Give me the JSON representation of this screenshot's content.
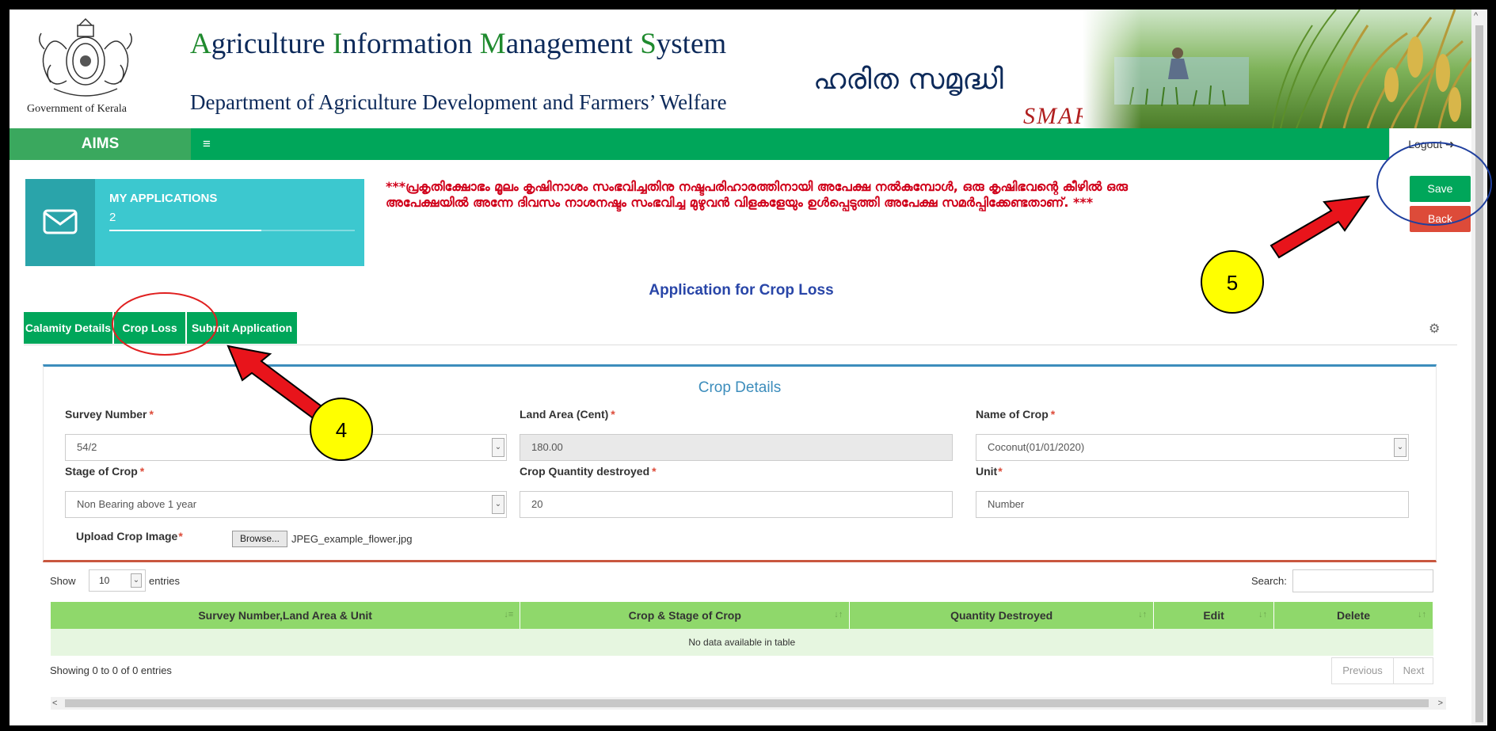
{
  "header": {
    "gov_label": "Government of Kerala",
    "title_parts": [
      {
        "cap": "A",
        "rest": "griculture "
      },
      {
        "cap": "I",
        "rest": "nformation "
      },
      {
        "cap": "M",
        "rest": "anagement "
      },
      {
        "cap": "S",
        "rest": "ystem"
      }
    ],
    "subtitle": "Department of Agriculture Development and Farmers’ Welfare",
    "malayalam_logo": "ഹരിത സമൃദ്ധി",
    "smart_logo": "SMART"
  },
  "nav": {
    "brand": "AIMS",
    "menu_icon": "≡",
    "logout_label": "Logout ➜"
  },
  "applications": {
    "label": "MY APPLICATIONS",
    "count": "2",
    "progress": 0.62
  },
  "notice": "***പ്രകൃതിക്ഷോഭം മൂലം കൃഷിനാശം സംഭവിച്ചതിനു നഷ്ടപരിഹാരത്തിനായി അപേക്ഷ നൽകുമ്പോൾ, ഒരു കൃഷിഭവന്റെ കീഴിൽ ഒരു അപേക്ഷയിൽ അന്നേ ദിവസം നാശനഷ്ടം സംഭവിച്ച മുഴുവൻ വിളകളേയും ഉൾപ്പെടുത്തി അപേക്ഷ സമർപ്പിക്കേണ്ടതാണ്. ***",
  "actions": {
    "save_label": "Save",
    "back_label": "Back"
  },
  "page_heading": "Application for Crop Loss",
  "tabs": [
    {
      "label": "Calamity Details"
    },
    {
      "label": "Crop Loss"
    },
    {
      "label": "Submit Application"
    }
  ],
  "settings_icon": "gear-icon",
  "crop_details": {
    "title": "Crop Details",
    "survey_number": {
      "label": "Survey Number",
      "value": "54/2"
    },
    "land_area": {
      "label": "Land Area (Cent)",
      "value": "180.00"
    },
    "crop_name": {
      "label": "Name of Crop",
      "value": "Coconut(01/01/2020)"
    },
    "stage": {
      "label": "Stage of Crop",
      "value": "Non Bearing above 1 year"
    },
    "quantity": {
      "label": "Crop Quantity destroyed",
      "value": "20"
    },
    "unit": {
      "label": "Unit",
      "value": "Number"
    },
    "upload": {
      "label": "Upload Crop Image",
      "button": "Browse...",
      "file_name": "JPEG_example_flower.jpg"
    }
  },
  "table_controls": {
    "show_label": "Show",
    "length_value": "10",
    "entries_label": "entries",
    "search_label": "Search:"
  },
  "table": {
    "columns": [
      {
        "label": "Survey Number,Land Area & Unit"
      },
      {
        "label": "Crop & Stage of Crop"
      },
      {
        "label": "Quantity Destroyed"
      },
      {
        "label": "Edit"
      },
      {
        "label": "Delete"
      }
    ],
    "empty_message": "No data available in table",
    "info": "Showing 0 to 0 of 0 entries",
    "previous_label": "Previous",
    "next_label": "Next"
  },
  "annotations": {
    "step4": "4",
    "step5": "5",
    "arrow_color": "#e8141b",
    "ring_red": "#e02020",
    "ring_blue": "#1f3f9e",
    "callout_color": "#ffff00"
  },
  "colors": {
    "green": "#00a65a",
    "red": "#dd4b39",
    "teal": "#3cc8cf",
    "header_green": "#8fd86b"
  }
}
